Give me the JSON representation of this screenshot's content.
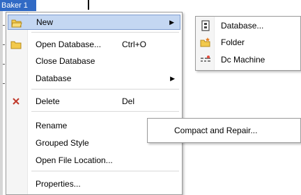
{
  "background": {
    "tree_node": "Baker 1"
  },
  "context_menu": {
    "new": {
      "label": "New",
      "icon": "open-folder-icon"
    },
    "open_database": {
      "label": "Open Database...",
      "shortcut": "Ctrl+O",
      "icon": "folder-icon"
    },
    "close_database": {
      "label": "Close Database"
    },
    "database": {
      "label": "Database"
    },
    "delete": {
      "label": "Delete",
      "shortcut": "Del",
      "icon": "red-x-icon"
    },
    "rename": {
      "label": "Rename"
    },
    "grouped_style": {
      "label": "Grouped Style"
    },
    "open_file_location": {
      "label": "Open File Location..."
    },
    "properties": {
      "label": "Properties..."
    }
  },
  "new_submenu": {
    "database": {
      "label": "Database...",
      "icon": "database-icon"
    },
    "folder": {
      "label": "Folder",
      "icon": "new-folder-icon"
    },
    "dc_machine": {
      "label": "Dc Machine",
      "icon": "dc-machine-icon"
    }
  },
  "database_submenu": {
    "compact_repair": {
      "label": "Compact and Repair..."
    }
  },
  "colors": {
    "highlight": "#c4d7f2",
    "highlight_border": "#7c9bcf",
    "selection": "#316ac5",
    "delete_x": "#c0392b"
  }
}
